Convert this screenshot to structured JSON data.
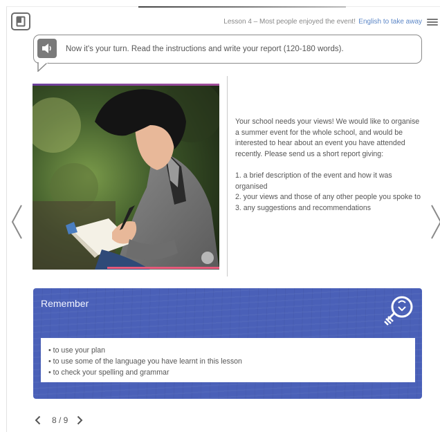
{
  "header": {
    "lesson_title": "Lesson 4 – Most people enjoyed the event!",
    "link_label": "English to take away",
    "icons": {
      "book": "book-icon",
      "menu": "hamburger-menu-icon"
    }
  },
  "instruction": {
    "text": "Now it's your turn. Read the instructions and write your report (120-180 words).",
    "icon": "speaker-icon"
  },
  "task": {
    "paragraph": "Your school needs your views! We would like to organise a summer event for the whole school, and would be interested to hear about an event you have attended recently. Please send us a short report giving:",
    "points": [
      "1. a brief description of the event and how it was organised",
      "2. your views and those of any other people you spoke to",
      "3. any suggestions and recommendations"
    ]
  },
  "remember": {
    "title": "Remember",
    "icon": "lightbulb-icon",
    "items": [
      "to use your plan",
      "to use some of the language you have learnt in this lesson",
      "to check your spelling and grammar"
    ]
  },
  "pager": {
    "count": "8 / 9"
  },
  "colors": {
    "remember_bg": "#4a60b8",
    "link": "#5b86c6",
    "photo_accent": "#a24d9a",
    "photo_bottom_accent": "#e85a7a"
  }
}
